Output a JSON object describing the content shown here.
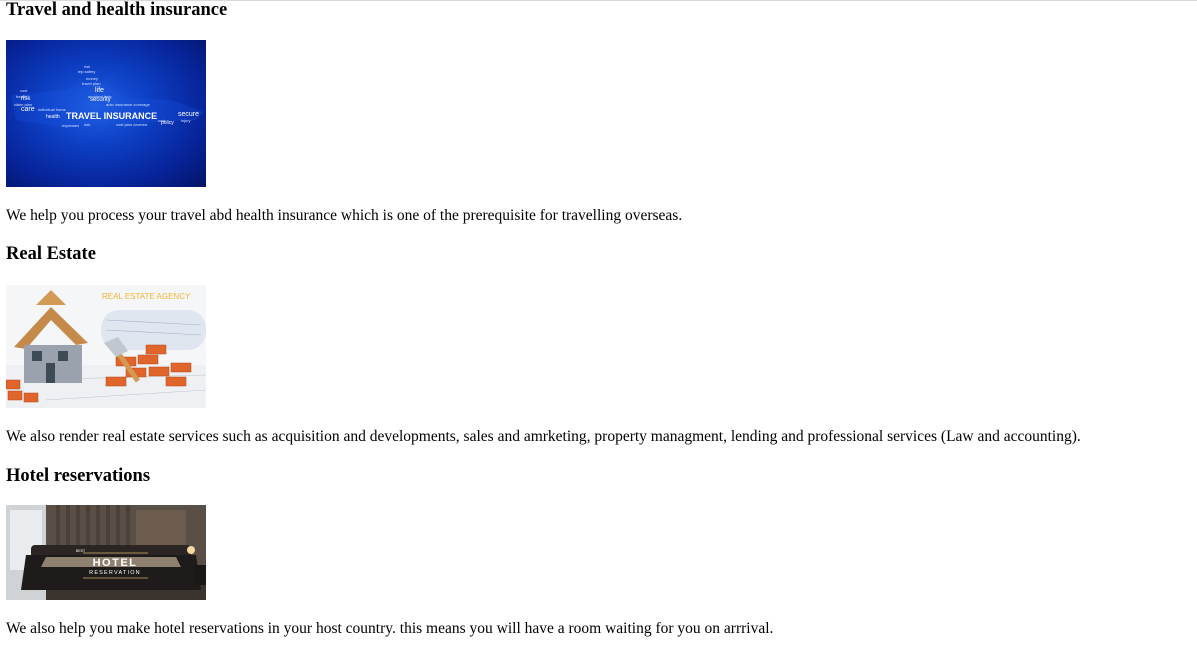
{
  "sections": [
    {
      "title": "Travel and health insurance",
      "image_text": {
        "main": "TRAVEL INSURANCE",
        "words": [
          "life",
          "security",
          "risk",
          "care",
          "health",
          "secure",
          "policy",
          "trip",
          "safety",
          "money",
          "travel"
        ]
      },
      "description": "We help you process your travel abd health insurance which is one of the prerequisite for travelling overseas."
    },
    {
      "title": "Real Estate",
      "image_text": {
        "agency": "REAL ESTATE AGENCY"
      },
      "description": "We also render real estate services such as acquisition and developments, sales and amrketing, property managment, lending and professional services (Law and accounting)."
    },
    {
      "title": "Hotel reservations",
      "image_text": {
        "small": "BEST",
        "main": "HOTEL",
        "sub": "RESERVATION"
      },
      "description": "We also help you make hotel reservations in your host country. this means you will have a room waiting for you on arrrival."
    }
  ],
  "colors": {
    "insurance_blue": "#0d3fc4",
    "agency_text": "#f2b632",
    "brick": "#e0652a"
  }
}
